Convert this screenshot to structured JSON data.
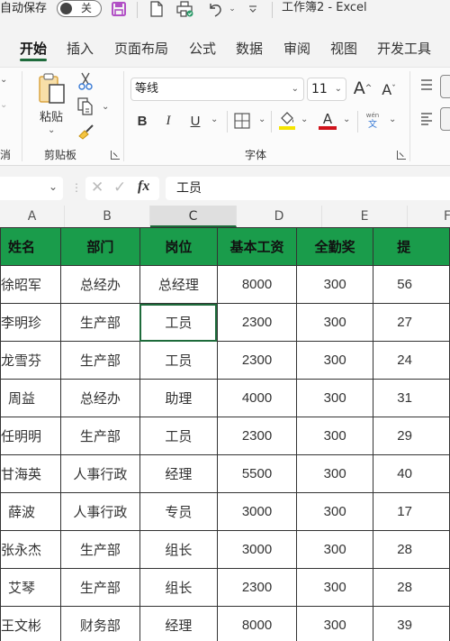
{
  "titlebar": {
    "autosave_label": "自动保存",
    "autosave_state": "关",
    "doc_title": "工作簿2  -  Excel",
    "icons": [
      "save-icon",
      "new-file-icon",
      "print-preview-icon",
      "undo-icon",
      "dropdown-icon",
      "customize-qat-icon"
    ]
  },
  "tabs": [
    {
      "label": "开始",
      "active": true
    },
    {
      "label": "插入"
    },
    {
      "label": "页面布局"
    },
    {
      "label": "公式"
    },
    {
      "label": "数据"
    },
    {
      "label": "审阅"
    },
    {
      "label": "视图"
    },
    {
      "label": "开发工具"
    }
  ],
  "ribbon": {
    "clipboard": {
      "paste_label": "粘贴",
      "group_label": "剪贴板"
    },
    "font": {
      "font_name": "等线",
      "font_size": "11",
      "group_label": "字体",
      "bold": "B",
      "italic": "I",
      "underline": "U",
      "grow": "A",
      "shrink": "A",
      "font_color_letter": "A",
      "phonetic_top": "wén",
      "phonetic_bottom": "文",
      "fill_color": "#f5e400",
      "font_color": "#d0121b"
    },
    "left_partial_label": "消"
  },
  "formula_bar": {
    "fx": "fx",
    "value": "工员"
  },
  "columns": [
    "A",
    "B",
    "C",
    "D",
    "E",
    "F"
  ],
  "selected_column": "C",
  "sheet": {
    "header_color": "#1a9c4b",
    "headers": [
      "姓名",
      "部门",
      "岗位",
      "基本工资",
      "全勤奖",
      "提"
    ],
    "rows": [
      [
        "徐昭军",
        "总经办",
        "总经理",
        "8000",
        "300",
        "56"
      ],
      [
        "李明珍",
        "生产部",
        "工员",
        "2300",
        "300",
        "27"
      ],
      [
        "龙雪芬",
        "生产部",
        "工员",
        "2300",
        "300",
        "24"
      ],
      [
        "周益",
        "总经办",
        "助理",
        "4000",
        "300",
        "31"
      ],
      [
        "任明明",
        "生产部",
        "工员",
        "2300",
        "300",
        "29"
      ],
      [
        "甘海英",
        "人事行政",
        "经理",
        "5500",
        "300",
        "40"
      ],
      [
        "薛波",
        "人事行政",
        "专员",
        "3000",
        "300",
        "17"
      ],
      [
        "张永杰",
        "生产部",
        "组长",
        "3000",
        "300",
        "28"
      ],
      [
        "艾琴",
        "生产部",
        "组长",
        "2300",
        "300",
        "28"
      ],
      [
        "王文彬",
        "财务部",
        "经理",
        "8000",
        "300",
        "39"
      ]
    ]
  }
}
